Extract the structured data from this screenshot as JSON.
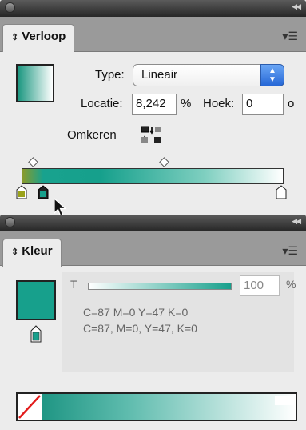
{
  "gradient_panel": {
    "tab_label": "Verloop",
    "type_label": "Type:",
    "type_value": "Lineair",
    "location_label": "Locatie:",
    "location_value": "8,242",
    "location_unit": "%",
    "angle_label": "Hoek:",
    "angle_value": "0",
    "angle_unit": "o",
    "reverse_label": "Omkeren"
  },
  "color_panel": {
    "tab_label": "Kleur",
    "tint_label": "T",
    "tint_value": "100",
    "tint_unit": "%",
    "cmyk_line1": "C=87 M=0 Y=47 K=0",
    "cmyk_line2": "C=87, M=0, Y=47, K=0"
  },
  "colors": {
    "swatch": "#17a08c",
    "stop_left": "#9aa21a",
    "stop_second": "#17a08c"
  },
  "icons": {
    "panel_menu": "menu-icon",
    "collapse": "collapse-icon",
    "reverse": "reverse-gradient-icon",
    "none_swatch": "none-color-icon",
    "cursor": "arrow-cursor-icon"
  }
}
